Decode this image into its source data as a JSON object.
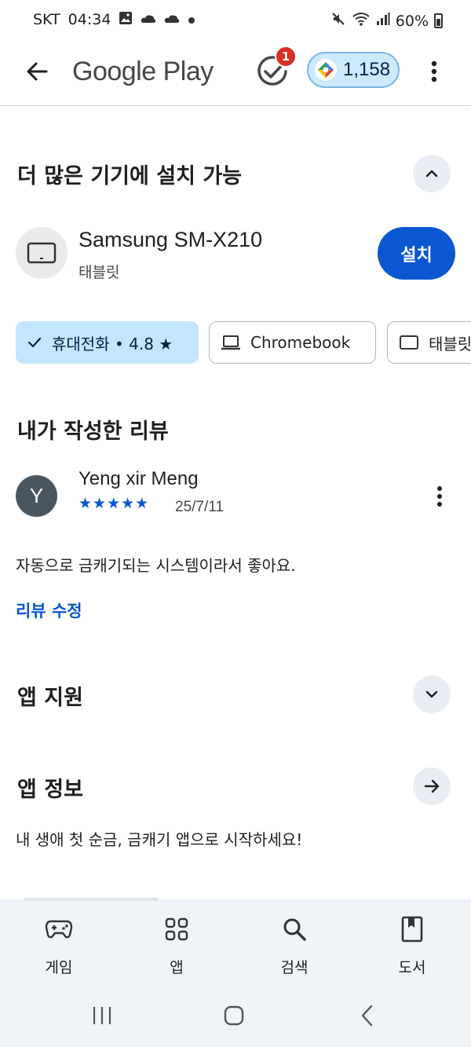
{
  "status_bar": {
    "carrier": "SKT",
    "time": "04:34",
    "battery": "60%"
  },
  "app_bar": {
    "title": "Google Play",
    "rewards_badge": "1",
    "points": "1,158"
  },
  "install_section": {
    "title": "더 많은 기기에 설치 가능",
    "device_name": "Samsung SM-X210",
    "device_type": "태블릿",
    "install_label": "설치",
    "chips": [
      {
        "label": "휴대전화 • 4.8 ★",
        "selected": true
      },
      {
        "label": "Chromebook",
        "selected": false
      },
      {
        "label": "태블릿",
        "selected": false
      }
    ]
  },
  "my_review": {
    "title": "내가 작성한 리뷰",
    "avatar_initial": "Y",
    "reviewer": "Yeng xir Meng",
    "stars": "★★★★★",
    "rating": 5,
    "date": "25/7/11",
    "body": "자동으로 금캐기되는 시스템이라서 좋아요.",
    "edit_label": "리뷰 수정"
  },
  "app_support": {
    "title": "앱 지원"
  },
  "app_info": {
    "title": "앱 정보",
    "description": "내 생애 첫 순금, 금캐기 앱으로 시작하세요!"
  },
  "bottom_nav": {
    "items": [
      {
        "label": "게임",
        "icon": "gamepad-icon"
      },
      {
        "label": "앱",
        "icon": "apps-grid-icon"
      },
      {
        "label": "검색",
        "icon": "search-icon"
      },
      {
        "label": "도서",
        "icon": "book-icon"
      }
    ]
  },
  "colors": {
    "accent_blue": "#0b57d0",
    "chip_selected": "#c2e7ff",
    "nav_background": "#f0f4f9",
    "badge_red": "#d93025"
  }
}
